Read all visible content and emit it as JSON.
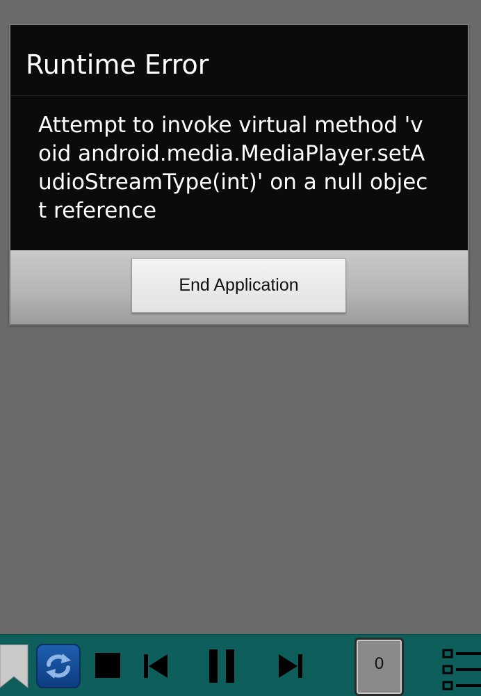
{
  "dialog": {
    "title": "Runtime Error",
    "message": "Attempt to invoke virtual method 'void android.media.MediaPlayer.setAudioStreamType(int)' on a null object reference",
    "button_label": "End Application"
  },
  "player_bar": {
    "counter_value": "0",
    "icons": [
      "bookmark-icon",
      "repeat-icon",
      "stop-icon",
      "previous-icon",
      "pause-icon",
      "next-icon",
      "playlist-icon"
    ]
  },
  "colors": {
    "background": "#6b6b6b",
    "dialog_background": "#0b0b0b",
    "player_bar": "#0e5f5c",
    "repeat_button": "#1f5fb0"
  }
}
